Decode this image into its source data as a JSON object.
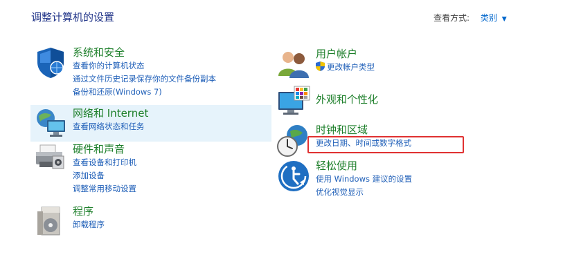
{
  "header": {
    "title": "调整计算机的设置",
    "view_by_label": "查看方式:",
    "view_by_value": "类别"
  },
  "categories": [
    {
      "title": "系统和安全",
      "links": [
        "查看你的计算机状态",
        "通过文件历史记录保存你的文件备份副本",
        "备份和还原(Windows 7)"
      ],
      "icon": "security-shield-icon"
    },
    {
      "title": "网络和 Internet",
      "links": [
        "查看网络状态和任务"
      ],
      "icon": "network-globe-icon"
    },
    {
      "title": "硬件和声音",
      "links": [
        "查看设备和打印机",
        "添加设备",
        "调整常用移动设置"
      ],
      "icon": "printer-icon"
    },
    {
      "title": "程序",
      "links": [
        "卸载程序"
      ],
      "icon": "programs-icon"
    },
    {
      "title": "用户帐户",
      "links": [
        "更改帐户类型"
      ],
      "icon": "users-icon"
    },
    {
      "title": "外观和个性化",
      "links": [],
      "icon": "monitor-palette-icon"
    },
    {
      "title": "时钟和区域",
      "links": [
        "更改日期、时间或数字格式"
      ],
      "icon": "clock-globe-icon"
    },
    {
      "title": "轻松使用",
      "links": [
        "使用 Windows 建议的设置",
        "优化视觉显示"
      ],
      "icon": "ease-of-access-icon"
    }
  ],
  "colors": {
    "title": "#1e3287",
    "category_title": "#1d7f2a",
    "link": "#1f5fb8",
    "highlight_bg": "#e6f3fb",
    "annotation_box": "#e03131"
  }
}
